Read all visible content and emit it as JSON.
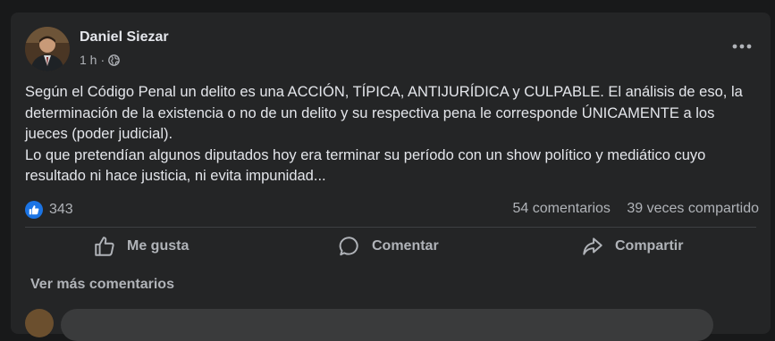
{
  "post": {
    "author": "Daniel Siezar",
    "time": "1 h",
    "dot": "·",
    "privacy_icon": "globe-icon",
    "menu_icon": "more-horizontal-icon",
    "paragraphs": [
      "Según el Código Penal un delito es una ACCIÓN, TÍPICA, ANTIJURÍDICA y CULPABLE. El análisis de eso, la determinación de la existencia o no de un delito y su respectiva pena le corresponde ÚNICAMENTE a los jueces (poder judicial).",
      "Lo que pretendían algunos diputados hoy era terminar su período con un show político y mediático cuyo resultado ni hace justicia, ni evita impunidad..."
    ]
  },
  "engagement": {
    "reaction_icon": "like-icon",
    "reaction_count": "343",
    "comments": "54 comentarios",
    "shares": "39 veces compartido"
  },
  "actions": {
    "like": "Me gusta",
    "comment": "Comentar",
    "share": "Compartir"
  },
  "comments_section": {
    "see_more": "Ver más comentarios"
  },
  "colors": {
    "page_bg": "#18191a",
    "card_bg": "#242526",
    "primary_text": "#e4e6eb",
    "secondary_text": "#b0b3b8",
    "like_blue": "#1b74e4"
  }
}
